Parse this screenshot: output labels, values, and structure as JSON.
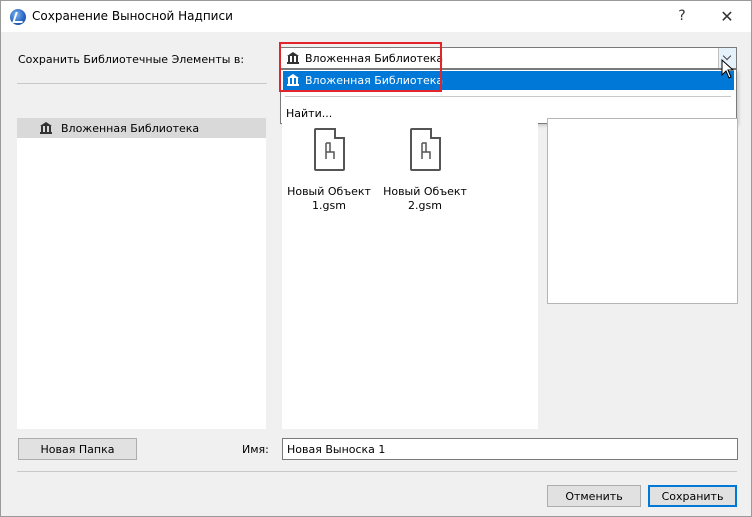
{
  "window": {
    "title": "Сохранение Выносной Надписи",
    "help_label": "?",
    "close_label": "✕"
  },
  "save_to": {
    "label": "Сохранить Библиотечные Элементы в:",
    "selected_value": "Вложенная Библиотека",
    "dropdown_options": [
      "Вложенная Библиотека",
      "Найти..."
    ]
  },
  "library_tree": {
    "items": [
      {
        "label": "Вложенная Библиотека"
      }
    ]
  },
  "files": [
    {
      "name_line1": "Новый Объект",
      "name_line2": "1.gsm",
      "icon": "chair-document-icon"
    },
    {
      "name_line1": "Новый Объект",
      "name_line2": "2.gsm",
      "icon": "chair-document-icon"
    }
  ],
  "footer": {
    "new_folder_label": "Новая Папка",
    "name_label": "Имя:",
    "name_value": "Новая Выноска 1",
    "cancel_label": "Отменить",
    "save_label": "Сохранить"
  },
  "colors": {
    "highlight": "#0078d7",
    "annotation_box": "#e2252b",
    "tree_selected_bg": "#d9d9d9"
  }
}
